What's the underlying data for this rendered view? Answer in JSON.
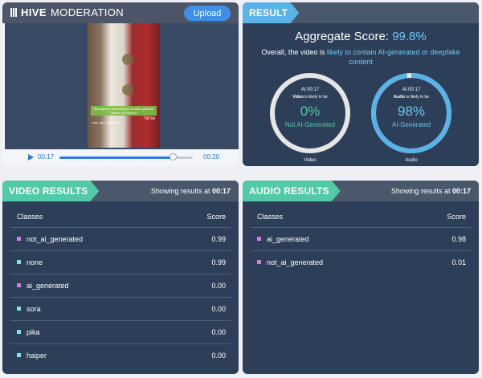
{
  "header": {
    "logo_bold": "HIVE",
    "logo_light": "MODERATION",
    "upload_label": "Upload"
  },
  "player": {
    "caption_top": "Ésta gente marchaba por la calle gritando 'Mexico de México'",
    "caption_bottom": "esa, Ajo y Ahorcado",
    "watermark": "TikTok",
    "current_time": "00:17",
    "end_time": "00:20",
    "progress": 0.85
  },
  "result": {
    "tag": "RESULT",
    "aggregate_label": "Aggregate Score:",
    "aggregate_value": "99.8%",
    "summary_prefix": "Overall, the video is",
    "summary_highlight": "likely to contain AI-generated or deepfake content",
    "gauges": [
      {
        "time": "At 00:17",
        "subject": "Video",
        "likely_text": "is likely to be",
        "percent": "0%",
        "fill": 0.0,
        "label": "Not AI-Generated",
        "name": "Video",
        "label_color": "#52c9a7"
      },
      {
        "time": "At 00:17",
        "subject": "Audio",
        "likely_text": "is likely to be",
        "percent": "98%",
        "fill": 0.98,
        "label": "AI-Generated",
        "name": "Audio",
        "label_color": "#6cc6f2"
      }
    ]
  },
  "video_results": {
    "tag": "VIDEO RESULTS",
    "showing_prefix": "Showing results at",
    "showing_time": "00:17",
    "col_classes": "Classes",
    "col_score": "Score",
    "rows": [
      {
        "cls": "not_ai_generated",
        "score": "0.99",
        "color": "#d77ae6"
      },
      {
        "cls": "none",
        "score": "0.99",
        "color": "#7ee1f2"
      },
      {
        "cls": "ai_generated",
        "score": "0.00",
        "color": "#d77ae6"
      },
      {
        "cls": "sora",
        "score": "0.00",
        "color": "#7ee1f2"
      },
      {
        "cls": "pika",
        "score": "0.00",
        "color": "#7ee1f2"
      },
      {
        "cls": "haiper",
        "score": "0.00",
        "color": "#7ee1f2"
      }
    ]
  },
  "audio_results": {
    "tag": "AUDIO RESULTS",
    "showing_prefix": "Showing results at",
    "showing_time": "00:17",
    "col_classes": "Classes",
    "col_score": "Score",
    "rows": [
      {
        "cls": "ai_generated",
        "score": "0.98",
        "color": "#d77ae6"
      },
      {
        "cls": "not_ai_generated",
        "score": "0.01",
        "color": "#d77ae6"
      }
    ]
  }
}
